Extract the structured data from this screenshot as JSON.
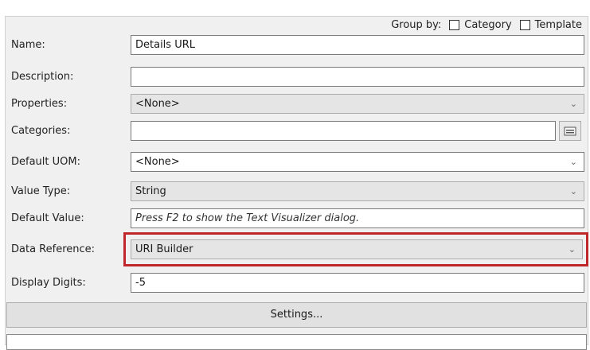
{
  "group_by": {
    "label": "Group by:",
    "category_label": "Category",
    "template_label": "Template"
  },
  "fields": {
    "name": {
      "label": "Name:",
      "value": "Details URL"
    },
    "description": {
      "label": "Description:",
      "value": ""
    },
    "properties": {
      "label": "Properties:",
      "value": "<None>"
    },
    "categories": {
      "label": "Categories:",
      "value": ""
    },
    "default_uom": {
      "label": "Default UOM:",
      "value": "<None>"
    },
    "value_type": {
      "label": "Value Type:",
      "value": "String"
    },
    "default_value": {
      "label": "Default Value:",
      "value": "Press F2 to show the Text Visualizer dialog."
    },
    "data_reference": {
      "label": "Data Reference:",
      "value": "URI Builder"
    },
    "display_digits": {
      "label": "Display Digits:",
      "value": "-5"
    }
  },
  "settings_label": "Settings...",
  "highlight_color": "#c0272d",
  "icons": {
    "dropdown": "chevron-down-icon",
    "browse": "browse-categories-icon"
  }
}
